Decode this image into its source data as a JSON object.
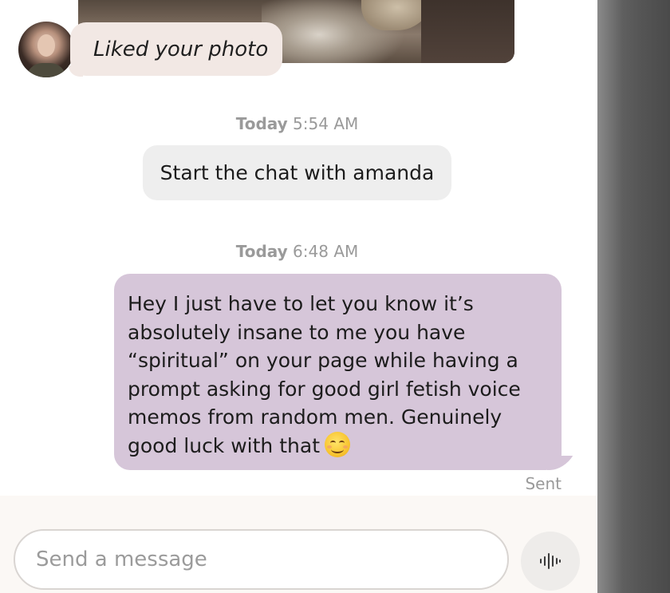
{
  "liked": {
    "text": "Liked your photo"
  },
  "timestamps": [
    {
      "day": "Today",
      "time": "5:54 AM"
    },
    {
      "day": "Today",
      "time": "6:48 AM"
    }
  ],
  "system_message": "Start the chat with amanda",
  "sent_message": {
    "lines": [
      "Hey I just have to let you know it’s",
      "absolutely insane to me you have",
      "“spiritual” on your page while having a",
      "prompt asking for good girl fetish voice",
      "memos from random men. Genuinely",
      "good luck with that"
    ],
    "emoji": "smiling-face-emoji",
    "status": "Sent"
  },
  "composer": {
    "placeholder": "Send a message",
    "voice_icon": "waveform-icon"
  },
  "colors": {
    "liked_bubble": "#f2e8e4",
    "sent_bubble": "#d6c6d9",
    "system_bubble": "#eeeeee",
    "timestamp_text": "#9a9a9a"
  }
}
